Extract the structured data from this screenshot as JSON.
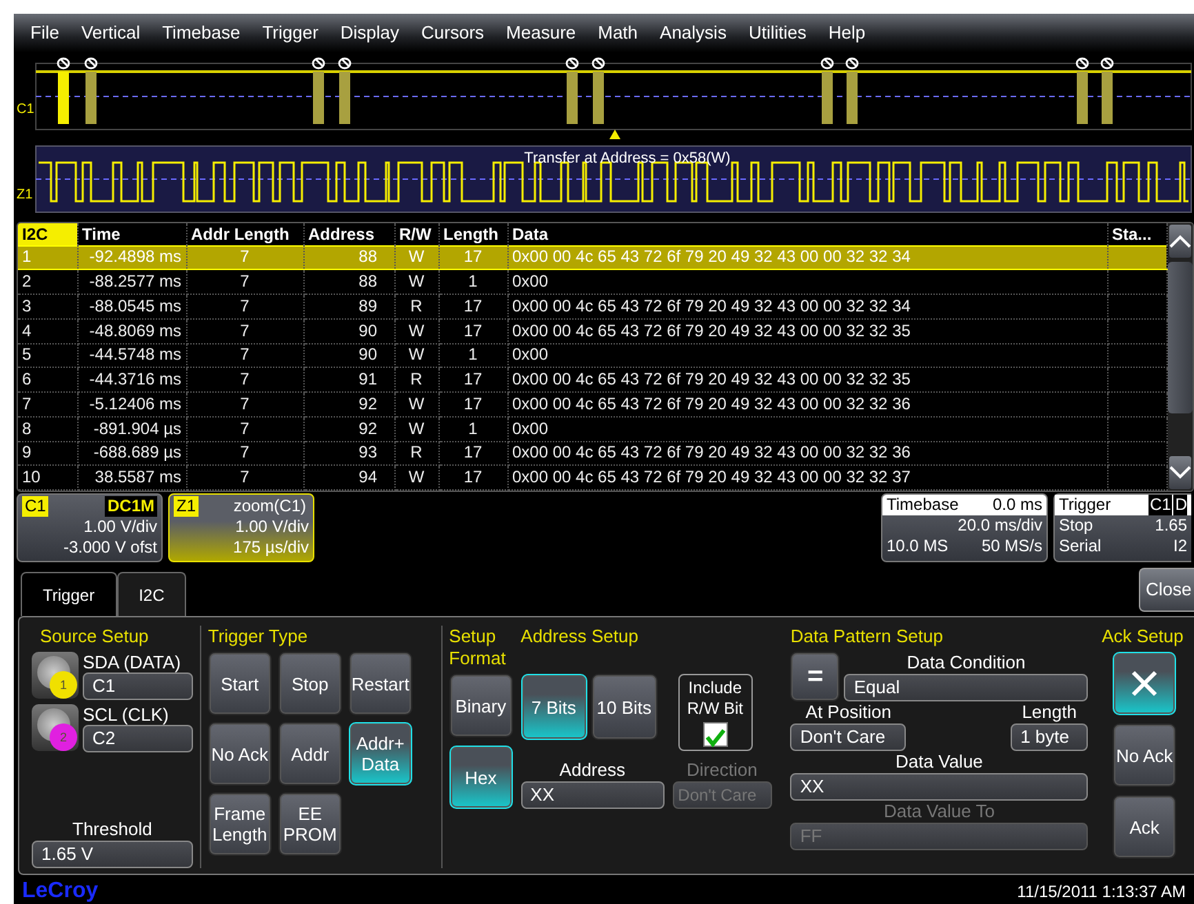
{
  "menu": [
    "File",
    "Vertical",
    "Timebase",
    "Trigger",
    "Display",
    "Cursors",
    "Measure",
    "Math",
    "Analysis",
    "Utilities",
    "Help"
  ],
  "traces": [
    {
      "label": "C1"
    },
    {
      "label": "Z1",
      "annotation": "Transfer at Address = 0x58(W)"
    }
  ],
  "table": {
    "columns": [
      "I2C",
      "Time",
      "Addr Length",
      "Address",
      "R/W",
      "Length",
      "Data",
      "Sta..."
    ],
    "rows": [
      {
        "selected": true,
        "cells": [
          "1",
          "-92.4898 ms",
          "7",
          "88",
          "W",
          "17",
          "0x00 00 4c 65 43 72 6f 79 20 49 32 43 00 00 32 32 34",
          ""
        ]
      },
      {
        "selected": false,
        "cells": [
          "2",
          "-88.2577 ms",
          "7",
          "88",
          "W",
          "1",
          "0x00",
          ""
        ]
      },
      {
        "selected": false,
        "cells": [
          "3",
          "-88.0545 ms",
          "7",
          "89",
          "R",
          "17",
          "0x00 00 4c 65 43 72 6f 79 20 49 32 43 00 00 32 32 34",
          ""
        ]
      },
      {
        "selected": false,
        "cells": [
          "4",
          "-48.8069 ms",
          "7",
          "90",
          "W",
          "17",
          "0x00 00 4c 65 43 72 6f 79 20 49 32 43 00 00 32 32 35",
          ""
        ]
      },
      {
        "selected": false,
        "cells": [
          "5",
          "-44.5748 ms",
          "7",
          "90",
          "W",
          "1",
          "0x00",
          ""
        ]
      },
      {
        "selected": false,
        "cells": [
          "6",
          "-44.3716 ms",
          "7",
          "91",
          "R",
          "17",
          "0x00 00 4c 65 43 72 6f 79 20 49 32 43 00 00 32 32 35",
          ""
        ]
      },
      {
        "selected": false,
        "cells": [
          "7",
          "-5.12406 ms",
          "7",
          "92",
          "W",
          "17",
          "0x00 00 4c 65 43 72 6f 79 20 49 32 43 00 00 32 32 36",
          ""
        ]
      },
      {
        "selected": false,
        "cells": [
          "8",
          "-891.904 µs",
          "7",
          "92",
          "W",
          "1",
          "0x00",
          ""
        ]
      },
      {
        "selected": false,
        "cells": [
          "9",
          "-688.689 µs",
          "7",
          "93",
          "R",
          "17",
          "0x00 00 4c 65 43 72 6f 79 20 49 32 43 00 00 32 32 36",
          ""
        ]
      },
      {
        "selected": false,
        "cells": [
          "10",
          "38.5587 ms",
          "7",
          "94",
          "W",
          "17",
          "0x00 00 4c 65 43 72 6f 79 20 49 32 43 00 00 32 32 37",
          ""
        ]
      }
    ]
  },
  "descriptors": [
    {
      "label": "C1",
      "tag": "DC1M",
      "lines": [
        "1.00 V/div",
        "-3.000 V ofst"
      ],
      "selected": false
    },
    {
      "label": "Z1",
      "tag": "zoom(C1)",
      "lines": [
        "1.00 V/div",
        "175 µs/div"
      ],
      "selected": true
    }
  ],
  "timebase": {
    "title": "Timebase",
    "delay": "0.0 ms",
    "scale": "20.0 ms/div",
    "samples": "10.0 MS",
    "rate": "50 MS/s"
  },
  "trigger": {
    "title": "Trigger",
    "source": "C1",
    "coupling": "D",
    "mode": "Stop",
    "level": "1.65",
    "type": "Serial",
    "protocol": "I2"
  },
  "tabs": [
    {
      "label": "Trigger",
      "selected": false
    },
    {
      "label": "I2C",
      "selected": true
    }
  ],
  "close_button": "Close",
  "source_setup": {
    "title": "Source Setup",
    "sources": [
      {
        "label": "SDA (DATA)",
        "value": "C1",
        "number": "1",
        "color": "#f0e000"
      },
      {
        "label": "SCL (CLK)",
        "value": "C2",
        "number": "2",
        "color": "#e020e0"
      }
    ],
    "threshold": {
      "label": "Threshold",
      "value": "1.65 V"
    }
  },
  "trigger_type": {
    "title": "Trigger Type",
    "buttons": [
      {
        "label": "Start",
        "selected": false
      },
      {
        "label": "Stop",
        "selected": false
      },
      {
        "label": "Restart",
        "selected": false
      },
      {
        "label": "No Ack",
        "selected": false
      },
      {
        "label": "Addr",
        "selected": false
      },
      {
        "label": "Addr+ Data",
        "selected": true
      },
      {
        "label": "Frame Length",
        "selected": false
      },
      {
        "label": "EE PROM",
        "selected": false
      }
    ]
  },
  "setup_format": {
    "title": "Setup Format",
    "buttons": [
      {
        "label": "Binary",
        "selected": false
      },
      {
        "label": "Hex",
        "selected": true
      }
    ]
  },
  "address_setup": {
    "title": "Address Setup",
    "buttons": [
      {
        "label": "7 Bits",
        "selected": true
      },
      {
        "label": "10 Bits",
        "selected": false
      }
    ],
    "include_rw": {
      "label": "Include R/W Bit",
      "checked": true
    },
    "address": {
      "label": "Address",
      "value": "XX"
    },
    "direction": {
      "label": "Direction",
      "value": "Don't Care",
      "disabled": true
    }
  },
  "data_pattern": {
    "title": "Data Pattern Setup",
    "condition_button": "=",
    "data_condition": {
      "label": "Data Condition",
      "value": "Equal"
    },
    "at_position": {
      "label": "At Position",
      "value": "Don't Care"
    },
    "length": {
      "label": "Length",
      "value": "1 byte"
    },
    "data_value": {
      "label": "Data Value",
      "value": "XX",
      "disabled": false
    },
    "data_value_to": {
      "label": "Data Value To",
      "value": "FF",
      "disabled": true
    }
  },
  "ack_setup": {
    "title": "Ack Setup",
    "buttons": [
      {
        "kind": "icon",
        "selected": true
      },
      {
        "kind": "text",
        "label": "No Ack",
        "selected": false
      },
      {
        "kind": "text",
        "label": "Ack",
        "selected": false
      }
    ]
  },
  "footer": {
    "brand": "LeCroy",
    "datetime": "11/15/2011 1:13:37 AM"
  }
}
